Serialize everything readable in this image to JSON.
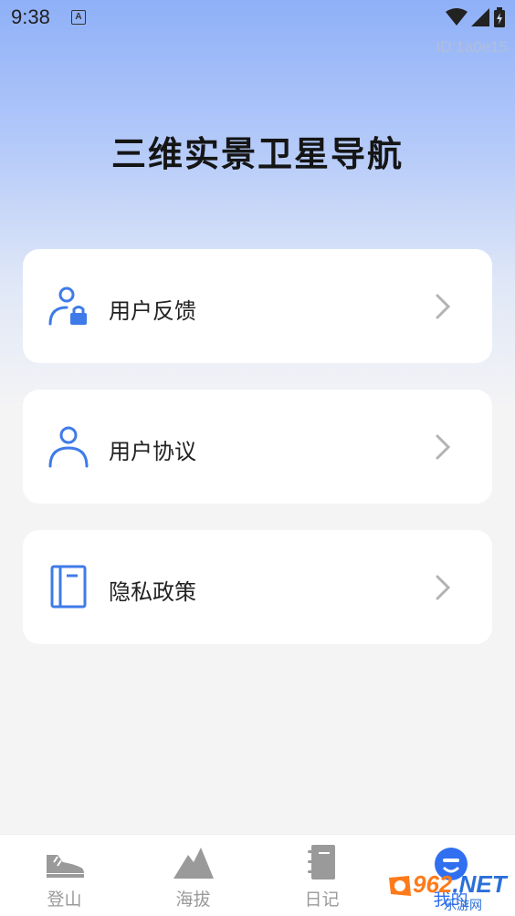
{
  "status_bar": {
    "time": "9:38",
    "notification_icon": "A"
  },
  "id_text": "ID:1a0e15",
  "app_title": "三维实景卫星导航",
  "menu": [
    {
      "label": "用户反馈",
      "icon": "user-lock-icon"
    },
    {
      "label": "用户协议",
      "icon": "user-icon"
    },
    {
      "label": "隐私政策",
      "icon": "book-icon"
    }
  ],
  "tabs": [
    {
      "label": "登山",
      "icon": "shoe-icon"
    },
    {
      "label": "海拔",
      "icon": "mountain-icon"
    },
    {
      "label": "日记",
      "icon": "notebook-icon"
    },
    {
      "label": "我的",
      "icon": "profile-icon",
      "active": true
    }
  ],
  "watermark": {
    "brand": "962",
    "suffix": ".NET",
    "sub": "乐游网"
  },
  "colors": {
    "accent": "#3f7be8",
    "tab_inactive": "#9a9a9a",
    "tab_active": "#2f6ff0"
  }
}
